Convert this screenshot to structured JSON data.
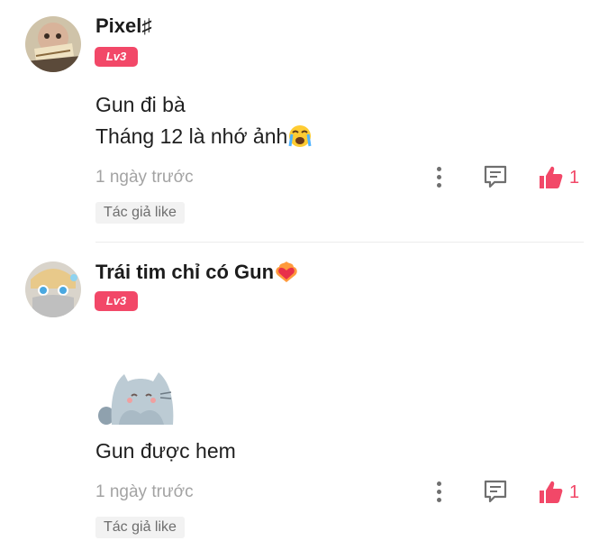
{
  "colors": {
    "accent": "#f24868",
    "badge": "#f24868",
    "timestamp": "#a3a3a3",
    "divider": "#ececec"
  },
  "comments": [
    {
      "username": "Pixel♯",
      "level": "Lv3",
      "lines": [
        "Gun đi bà",
        "Tháng 12 là nhớ ảnh"
      ],
      "line2_emoji": "loudly-crying-face",
      "timestamp": "1 ngày trước",
      "author_like": "Tác giả like",
      "like_count": "1",
      "icons": {
        "more": "more-vertical-icon",
        "reply": "comment-icon",
        "like": "thumbs-up-icon"
      }
    },
    {
      "username": "Trái tim chỉ có Gun",
      "username_emoji": "heart-on-fire",
      "level": "Lv3",
      "sticker": "cat-sticker",
      "lines": [
        "Gun được hem"
      ],
      "timestamp": "1 ngày trước",
      "author_like": "Tác giả like",
      "like_count": "1",
      "icons": {
        "more": "more-vertical-icon",
        "reply": "comment-icon",
        "like": "thumbs-up-icon"
      }
    }
  ]
}
